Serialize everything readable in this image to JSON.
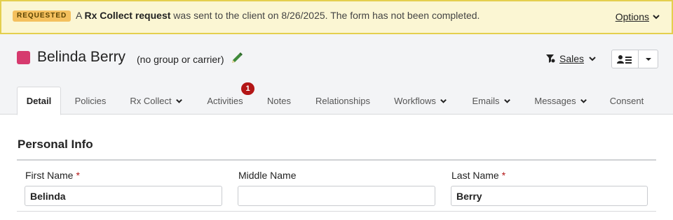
{
  "banner": {
    "badge": "REQUESTED",
    "msg_prefix": "A ",
    "msg_bold": "Rx Collect request",
    "msg_suffix": " was sent to the client on 8/26/2025. The form has not been completed.",
    "options_label": "Options"
  },
  "client": {
    "name": "Belinda Berry",
    "group": "(no group or carrier)",
    "swatch_color": "#d63a6e"
  },
  "header": {
    "pipeline_label": "Sales"
  },
  "tabs": [
    {
      "label": "Detail",
      "active": true
    },
    {
      "label": "Policies"
    },
    {
      "label": "Rx Collect",
      "dropdown": true
    },
    {
      "label": "Activities",
      "badge": "1"
    },
    {
      "label": "Notes"
    },
    {
      "label": "Relationships"
    },
    {
      "label": "Workflows",
      "dropdown": true
    },
    {
      "label": "Emails",
      "dropdown": true
    },
    {
      "label": "Messages",
      "dropdown": true
    },
    {
      "label": "Consent"
    }
  ],
  "personal_info": {
    "title": "Personal Info",
    "required_marker": "*",
    "first_name_label": "First Name",
    "first_name_value": "Belinda",
    "middle_name_label": "Middle Name",
    "middle_name_value": "",
    "last_name_label": "Last Name",
    "last_name_value": "Berry"
  }
}
